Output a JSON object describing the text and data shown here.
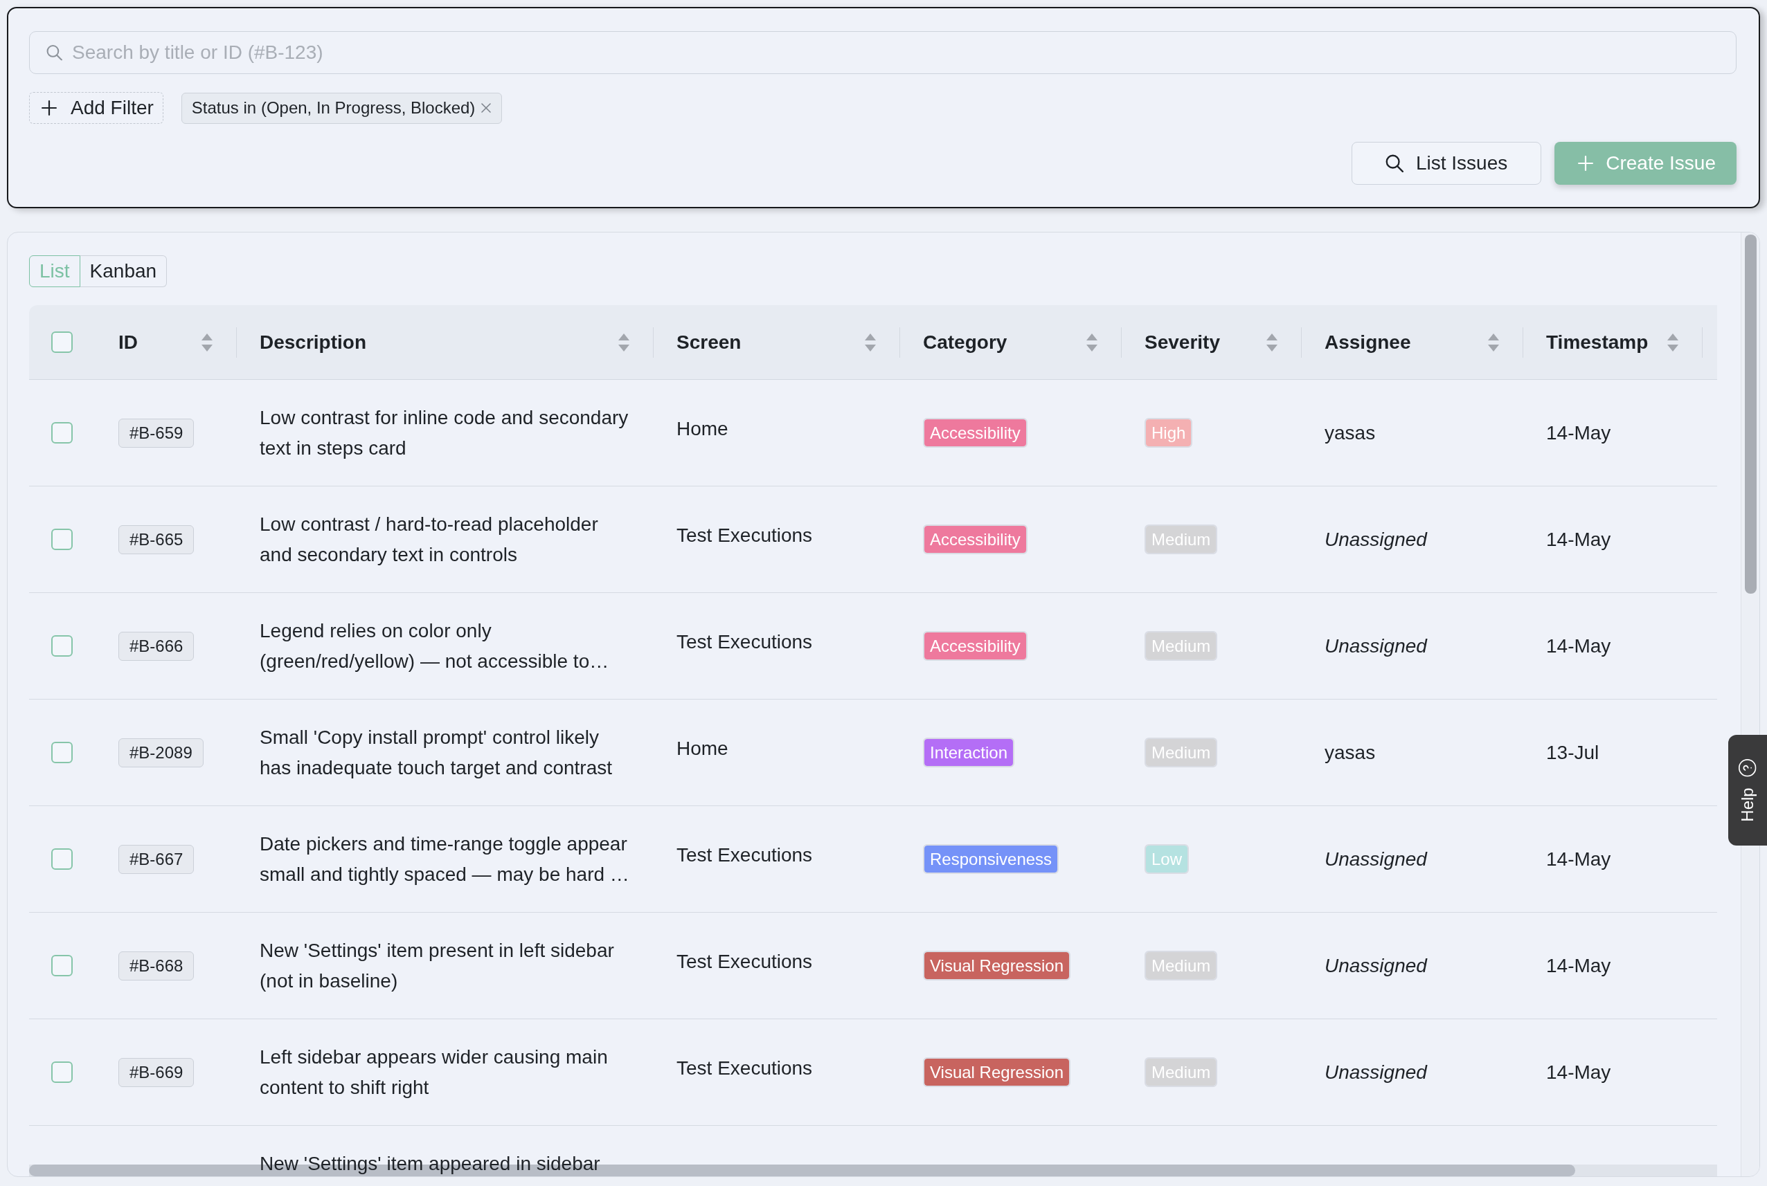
{
  "search": {
    "placeholder": "Search by title or ID (#B-123)"
  },
  "filters": {
    "add_button": "Add Filter",
    "chips": [
      {
        "label": "Status in (Open, In Progress, Blocked)"
      }
    ]
  },
  "actions": [
    {
      "label": "List Issues",
      "kind": "outline"
    },
    {
      "label": "Create Issue",
      "kind": "filled"
    }
  ],
  "view_tabs": [
    {
      "label": "List",
      "selected": true
    },
    {
      "label": "Kanban",
      "selected": false
    }
  ],
  "table": {
    "select_all_checked": false,
    "columns": [
      "ID",
      "Description",
      "Screen",
      "Category",
      "Severity",
      "Assignee",
      "Timestamp"
    ],
    "rows": [
      {
        "checked": false,
        "id": "#B-659",
        "description": "Low contrast for inline code and secondary text in steps card",
        "screen": "Home",
        "category": {
          "label": "Accessibility",
          "color": "#ee799d"
        },
        "severity": {
          "label": "High",
          "color": "#f4b0b2"
        },
        "assignee": {
          "name": "yasas",
          "unassigned": false
        },
        "timestamp": "14-May"
      },
      {
        "checked": false,
        "id": "#B-665",
        "description": "Low contrast / hard-to-read placeholder and secondary text in controls",
        "screen": "Test Executions",
        "category": {
          "label": "Accessibility",
          "color": "#ee799d"
        },
        "severity": {
          "label": "Medium",
          "color": "#d4d4d6"
        },
        "assignee": {
          "name": "Unassigned",
          "unassigned": true
        },
        "timestamp": "14-May"
      },
      {
        "checked": false,
        "id": "#B-666",
        "description": "Legend relies on color only (green/red/yellow) — not accessible to…",
        "screen": "Test Executions",
        "category": {
          "label": "Accessibility",
          "color": "#ee799d"
        },
        "severity": {
          "label": "Medium",
          "color": "#d4d4d6"
        },
        "assignee": {
          "name": "Unassigned",
          "unassigned": true
        },
        "timestamp": "14-May"
      },
      {
        "checked": false,
        "id": "#B-2089",
        "description": "Small 'Copy install prompt' control likely has inadequate touch target and contrast",
        "screen": "Home",
        "category": {
          "label": "Interaction",
          "color": "#b46ef6"
        },
        "severity": {
          "label": "Medium",
          "color": "#d4d4d6"
        },
        "assignee": {
          "name": "yasas",
          "unassigned": false
        },
        "timestamp": "13-Jul"
      },
      {
        "checked": false,
        "id": "#B-667",
        "description": "Date pickers and time-range toggle appear small and tightly spaced — may be hard …",
        "screen": "Test Executions",
        "category": {
          "label": "Responsiveness",
          "color": "#7592f8"
        },
        "severity": {
          "label": "Low",
          "color": "#b5e2e1"
        },
        "assignee": {
          "name": "Unassigned",
          "unassigned": true
        },
        "timestamp": "14-May"
      },
      {
        "checked": false,
        "id": "#B-668",
        "description": "New 'Settings' item present in left sidebar (not in baseline)",
        "screen": "Test Executions",
        "category": {
          "label": "Visual Regression",
          "color": "#c8645f"
        },
        "severity": {
          "label": "Medium",
          "color": "#d4d4d6"
        },
        "assignee": {
          "name": "Unassigned",
          "unassigned": true
        },
        "timestamp": "14-May"
      },
      {
        "checked": false,
        "id": "#B-669",
        "description": "Left sidebar appears wider causing main content to shift right",
        "screen": "Test Executions",
        "category": {
          "label": "Visual Regression",
          "color": "#c8645f"
        },
        "severity": {
          "label": "Medium",
          "color": "#d4d4d6"
        },
        "assignee": {
          "name": "Unassigned",
          "unassigned": true
        },
        "timestamp": "14-May"
      },
      {
        "description": "New 'Settings' item appeared in sidebar"
      }
    ]
  },
  "help_tab": "Help"
}
